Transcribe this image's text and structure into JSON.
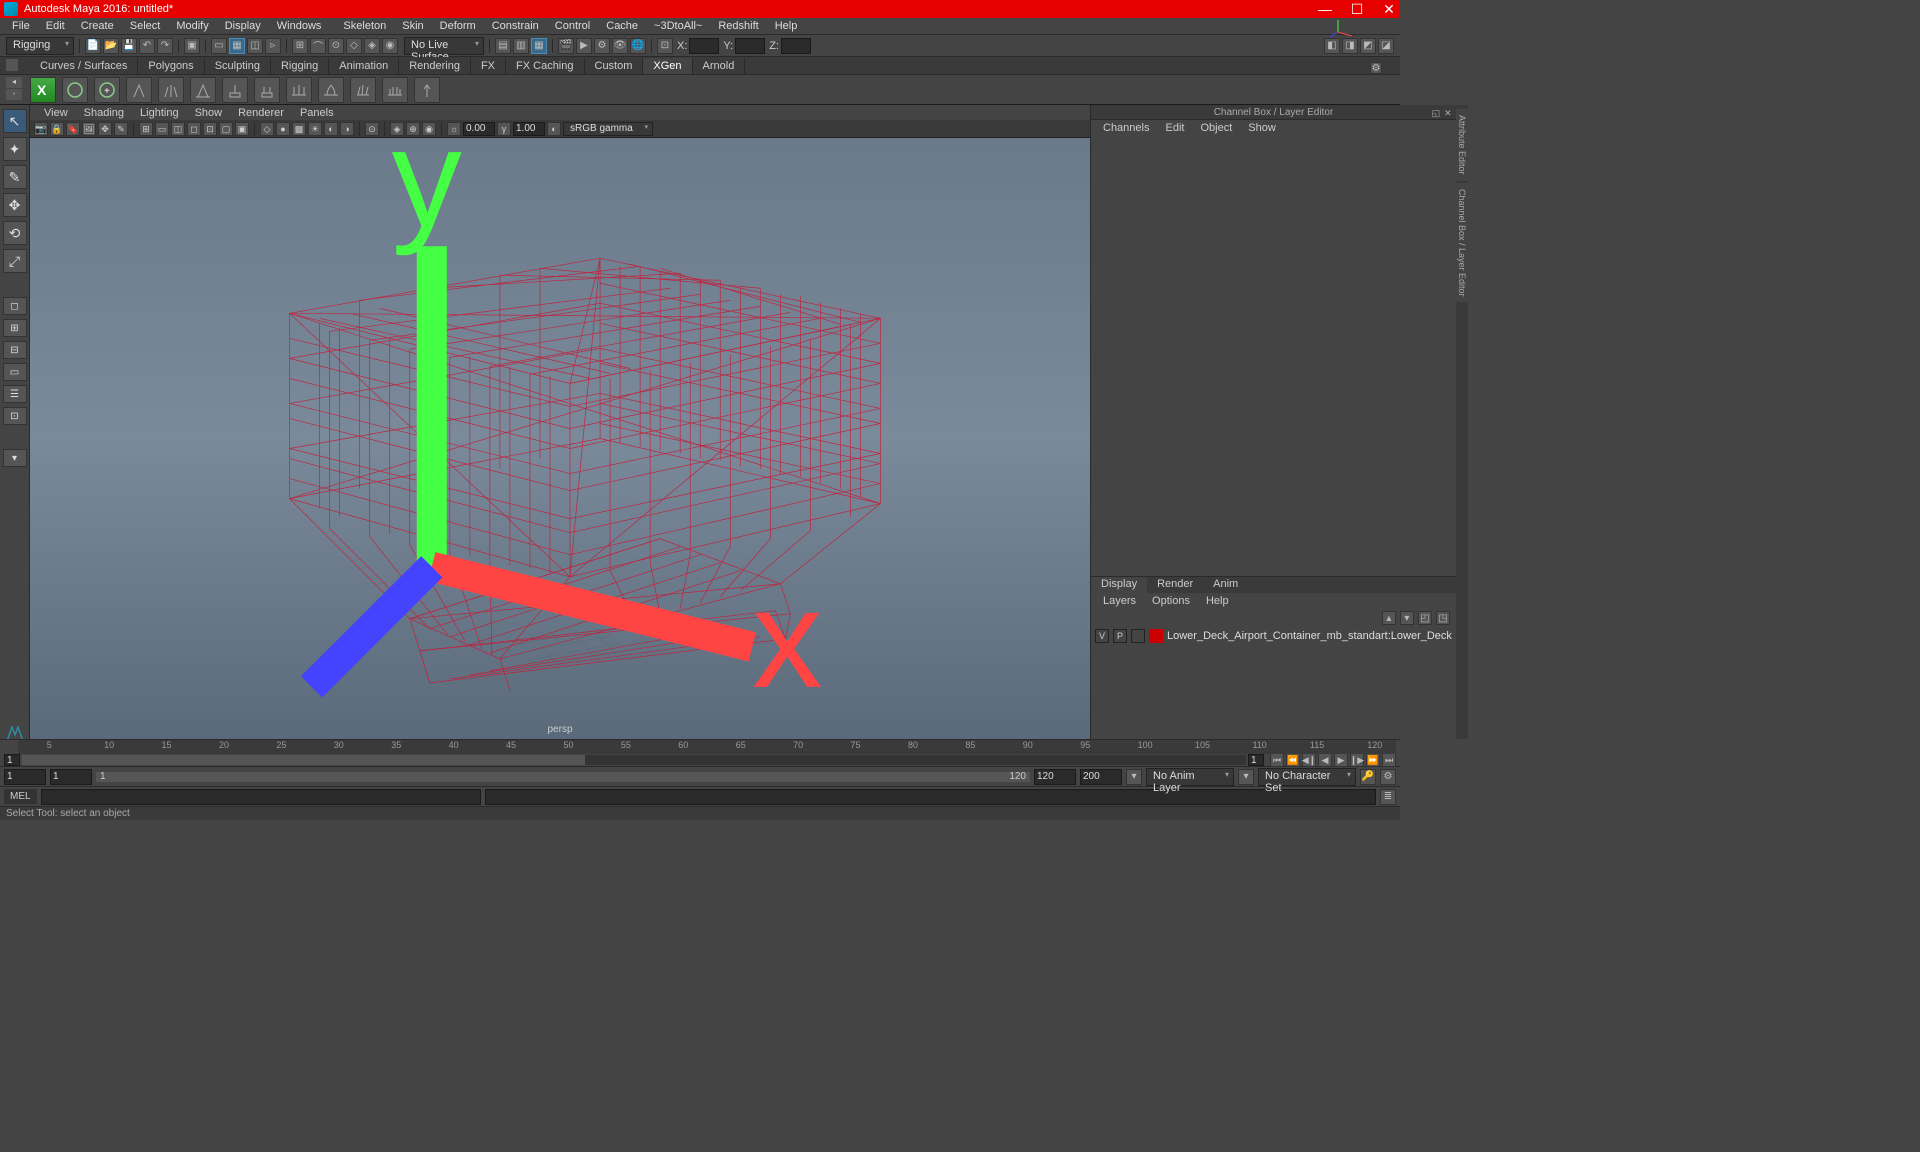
{
  "titlebar": {
    "title": "Autodesk Maya 2016: untitled*"
  },
  "menubar": {
    "items_left": [
      "File",
      "Edit",
      "Create",
      "Select",
      "Modify",
      "Display",
      "Windows"
    ],
    "items_right": [
      "Skeleton",
      "Skin",
      "Deform",
      "Constrain",
      "Control",
      "Cache",
      "~3DtoAll~",
      "Redshift",
      "Help"
    ]
  },
  "statusline": {
    "mode": "Rigging",
    "live_surface": "No Live Surface",
    "coord": {
      "x": "X:",
      "y": "Y:",
      "z": "Z:"
    }
  },
  "shelftabs": {
    "tabs": [
      "Curves / Surfaces",
      "Polygons",
      "Sculpting",
      "Rigging",
      "Animation",
      "Rendering",
      "FX",
      "FX Caching",
      "Custom",
      "XGen",
      "Arnold"
    ],
    "active": "XGen"
  },
  "panel": {
    "menus": [
      "View",
      "Shading",
      "Lighting",
      "Show",
      "Renderer",
      "Panels"
    ],
    "gamma_input": "0.00",
    "exposure_input": "1.00",
    "color_mgmt": "sRGB gamma",
    "camera_label": "persp"
  },
  "channelbox": {
    "title": "Channel Box / Layer Editor",
    "menus": [
      "Channels",
      "Edit",
      "Object",
      "Show"
    ]
  },
  "layereditor": {
    "tabs": [
      "Display",
      "Render",
      "Anim"
    ],
    "active_tab": "Display",
    "menus": [
      "Layers",
      "Options",
      "Help"
    ],
    "layers": [
      {
        "vis": "V",
        "playback": "P",
        "color": "#c00",
        "name": "Lower_Deck_Airport_Container_mb_standart:Lower_Deck"
      }
    ]
  },
  "sidetabs": {
    "tabs": [
      "Attribute Editor",
      "Channel Box / Layer Editor"
    ]
  },
  "timeslider": {
    "ticks": [
      "5",
      "10",
      "15",
      "20",
      "25",
      "30",
      "35",
      "40",
      "45",
      "50",
      "55",
      "60",
      "65",
      "70",
      "75",
      "80",
      "85",
      "90",
      "95",
      "100",
      "105",
      "110",
      "115",
      "120"
    ],
    "current": "1"
  },
  "rangeslider": {
    "start_in": "1",
    "start_out": "1",
    "mid_value": "1",
    "end_in": "120",
    "end_out": "120",
    "range_end": "120",
    "range_max": "200",
    "anim_layer": "No Anim Layer",
    "char_set": "No Character Set"
  },
  "cmdline": {
    "lang": "MEL"
  },
  "helpline": {
    "text": "Select Tool: select an object"
  }
}
